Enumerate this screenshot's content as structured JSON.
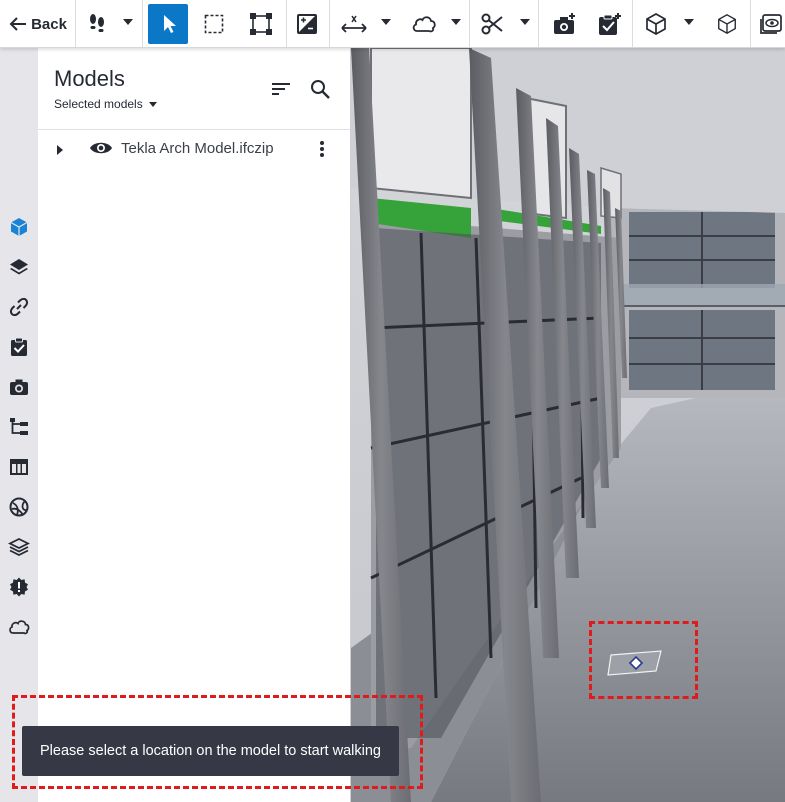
{
  "toolbar": {
    "back_label": "Back",
    "tools": [
      "walk-icon",
      "cursor-icon",
      "rect-select-icon",
      "fit-frame-icon",
      "contrast-icon",
      "measure-icon",
      "cloud-icon",
      "scissors-icon",
      "camera-add-icon",
      "clipboard-add-icon",
      "cube-icon",
      "cube-outline-icon",
      "eye-box-icon"
    ],
    "active_tool": "cursor-icon",
    "accent": "#0a77c7"
  },
  "rail": {
    "items": [
      "cube-icon",
      "layers-icon",
      "link-icon",
      "clipboard-check-icon",
      "camera-icon",
      "hierarchy-icon",
      "table-icon",
      "globe-icon",
      "stack-icon",
      "alert-badge-icon",
      "cloud-icon"
    ],
    "active": "cube-icon"
  },
  "panel": {
    "title": "Models",
    "subtitle": "Selected models",
    "models": [
      {
        "name": "Tekla Arch Model.ifczip",
        "visible": true
      }
    ]
  },
  "toast": {
    "message": "Please select a location on the model to start walking"
  },
  "highlight_color": "#e01b1b"
}
